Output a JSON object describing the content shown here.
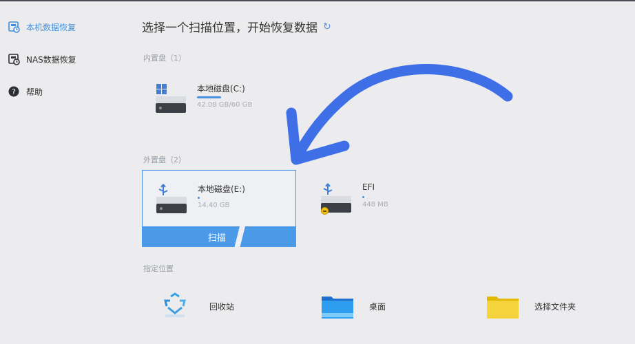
{
  "sidebar": {
    "items": [
      {
        "label": "本机数据恢复",
        "icon": "local-recovery-icon",
        "active": true
      },
      {
        "label": "NAS数据恢复",
        "icon": "nas-recovery-icon",
        "active": false
      },
      {
        "label": "帮助",
        "icon": "help-icon",
        "active": false
      }
    ]
  },
  "main": {
    "heading": "选择一个扫描位置，开始恢复数据",
    "refresh_icon": "refresh-icon",
    "internal_label": "内置盘（1）",
    "external_label": "外置盘（2）",
    "location_label": "指定位置",
    "internal_drives": [
      {
        "name": "本地磁盘(C:)",
        "size": "42.08 GB/60 GB",
        "icon": "windows-drive-icon",
        "usage": 0.7
      }
    ],
    "external_drives": [
      {
        "name": "本地磁盘(E:)",
        "size": "14.40 GB",
        "icon": "usb-drive-icon",
        "usage": 0.04,
        "selected": true,
        "action": "扫描"
      },
      {
        "name": "EFI",
        "size": "448 MB",
        "icon": "usb-drive-icon",
        "usage": 0.04,
        "selected": false,
        "badge": "warning-badge-icon"
      }
    ],
    "locations": [
      {
        "name": "回收站",
        "icon": "recycle-bin-icon"
      },
      {
        "name": "桌面",
        "icon": "desktop-folder-icon"
      },
      {
        "name": "选择文件夹",
        "icon": "folder-icon"
      }
    ]
  },
  "colors": {
    "accent": "#4b9ae8",
    "annotation_arrow": "#3f6fe6",
    "background": "#ececee"
  }
}
